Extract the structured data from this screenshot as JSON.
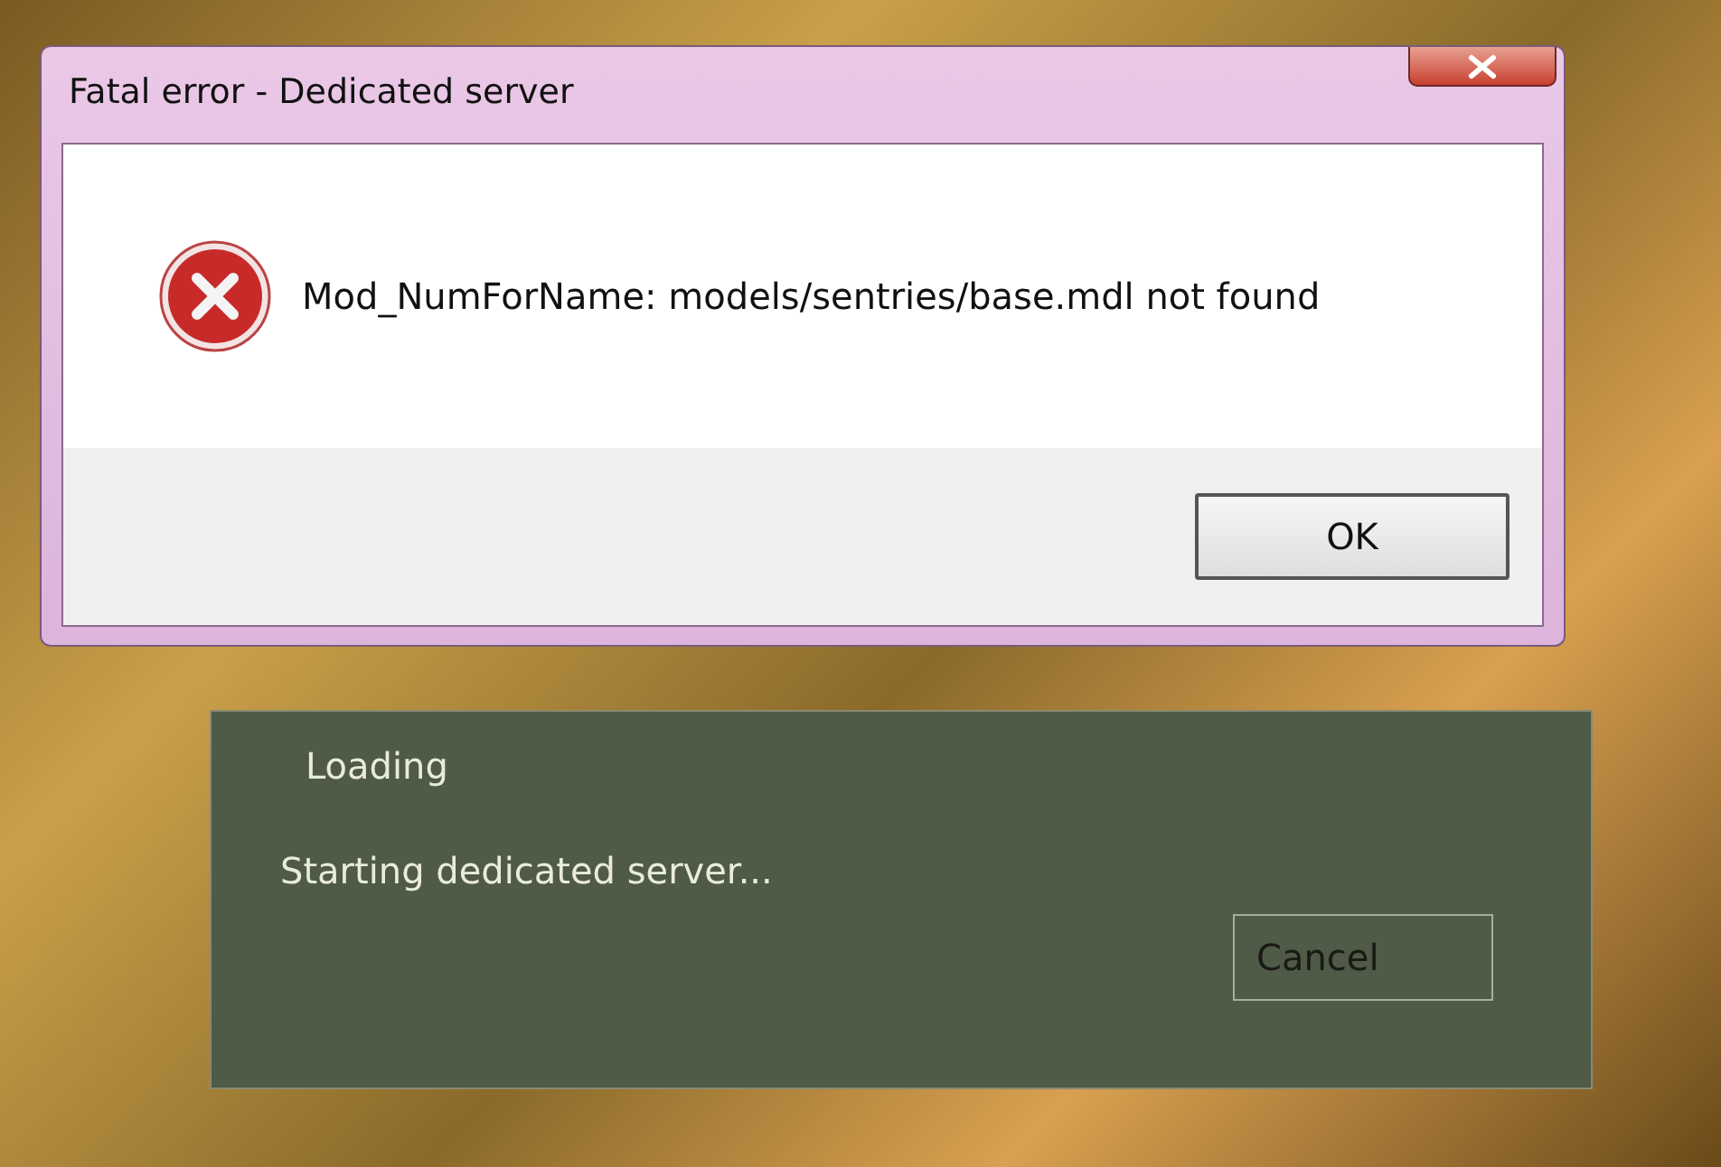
{
  "error_dialog": {
    "title": "Fatal error - Dedicated server",
    "message": "Mod_NumForName: models/sentries/base.mdl not found",
    "buttons": [
      "OK"
    ]
  },
  "loading_dialog": {
    "title": "Loading",
    "status": "Starting dedicated server...",
    "buttons": [
      "Cancel"
    ]
  }
}
